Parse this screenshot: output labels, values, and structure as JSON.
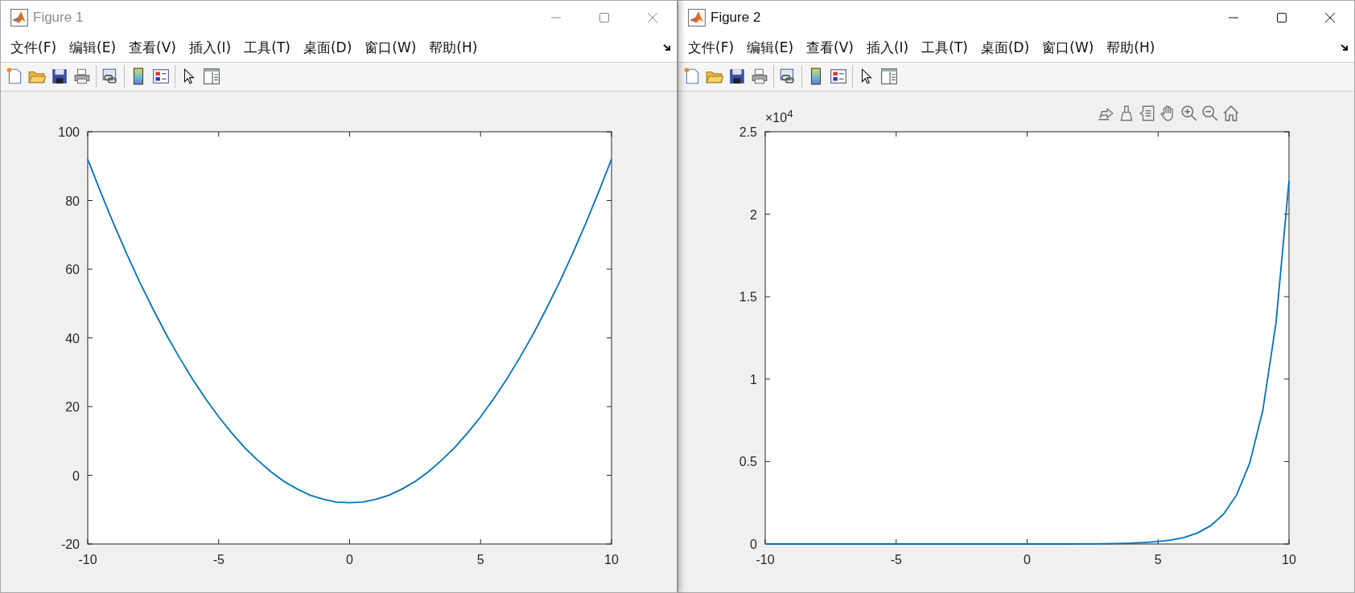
{
  "figures": [
    {
      "title": "Figure 1",
      "active": false,
      "axes_toolbar_visible": false,
      "menu": [
        "文件(F)",
        "编辑(E)",
        "查看(V)",
        "插入(I)",
        "工具(T)",
        "桌面(D)",
        "窗口(W)",
        "帮助(H)"
      ],
      "chart_data": {
        "type": "line",
        "xlim": [
          -10,
          10
        ],
        "ylim": [
          -20,
          100
        ],
        "xticks": [
          -10,
          -5,
          0,
          5,
          10
        ],
        "yticks": [
          -20,
          0,
          20,
          40,
          60,
          80,
          100
        ],
        "x": [
          -10,
          -9.5,
          -9,
          -8.5,
          -8,
          -7.5,
          -7,
          -6.5,
          -6,
          -5.5,
          -5,
          -4.5,
          -4,
          -3.5,
          -3,
          -2.5,
          -2,
          -1.5,
          -1,
          -0.5,
          0,
          0.5,
          1,
          1.5,
          2,
          2.5,
          3,
          3.5,
          4,
          4.5,
          5,
          5.5,
          6,
          6.5,
          7,
          7.5,
          8,
          8.5,
          9,
          9.5,
          10
        ],
        "series": [
          {
            "color": "#0072bd",
            "values": [
              92,
              82.3,
              73,
              64.3,
              56,
              48.3,
              41,
              34.3,
              28,
              22.3,
              17,
              12.3,
              8,
              4.3,
              1,
              -1.8,
              -4,
              -5.8,
              -7,
              -7.8,
              -8,
              -7.8,
              -7,
              -5.8,
              -4,
              -1.8,
              1,
              4.3,
              8,
              12.3,
              17,
              22.3,
              28,
              34.3,
              41,
              48.3,
              56,
              64.3,
              73,
              82.3,
              92
            ]
          }
        ]
      }
    },
    {
      "title": "Figure 2",
      "active": true,
      "axes_toolbar_visible": true,
      "axis_exponent": "×10$^{4}$",
      "menu": [
        "文件(F)",
        "编辑(E)",
        "查看(V)",
        "插入(I)",
        "工具(T)",
        "桌面(D)",
        "窗口(W)",
        "帮助(H)"
      ],
      "chart_data": {
        "type": "line",
        "xlim": [
          -10,
          10
        ],
        "ylim": [
          0,
          2.5
        ],
        "xticks": [
          -10,
          -5,
          0,
          5,
          10
        ],
        "yticks": [
          0,
          0.5,
          1,
          1.5,
          2,
          2.5
        ],
        "x": [
          -10,
          -9.5,
          -9,
          -8.5,
          -8,
          -7.5,
          -7,
          -6.5,
          -6,
          -5.5,
          -5,
          -4.5,
          -4,
          -3.5,
          -3,
          -2.5,
          -2,
          -1.5,
          -1,
          -0.5,
          0,
          0.5,
          1,
          1.5,
          2,
          2.5,
          3,
          3.5,
          4,
          4.5,
          5,
          5.5,
          6,
          6.5,
          7,
          7.5,
          8,
          8.5,
          9,
          9.5,
          10
        ],
        "series": [
          {
            "color": "#0072bd",
            "values": [
              0,
              0,
              0,
              0,
              0,
              0,
              0,
              0,
              0,
              0,
              0,
              0,
              0,
              0,
              0,
              0,
              0,
              0,
              0,
              0,
              0,
              0,
              0,
              0,
              0.001,
              0.001,
              0.002,
              0.003,
              0.005,
              0.009,
              0.015,
              0.024,
              0.04,
              0.067,
              0.11,
              0.181,
              0.298,
              0.491,
              0.81,
              1.336,
              2.203
            ]
          }
        ]
      }
    }
  ]
}
